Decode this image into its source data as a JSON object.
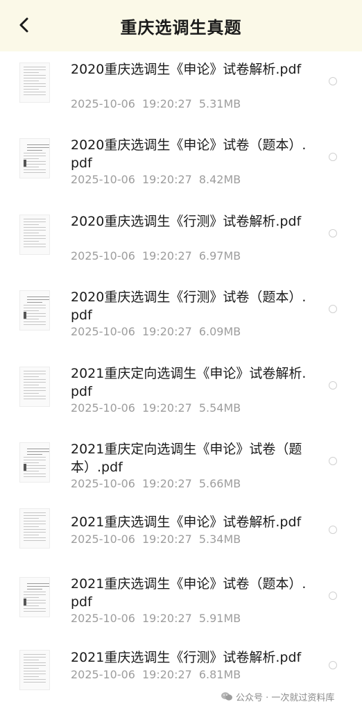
{
  "header": {
    "title": "重庆选调生真题",
    "back_icon": "back-arrow-icon"
  },
  "files": [
    {
      "name": "2020重庆选调生《申论》试卷解析.pdf",
      "date": "2025-10-06",
      "time": "19:20:27",
      "size": "5.31MB"
    },
    {
      "name": "2020重庆选调生《申论》试卷（题本）.pdf",
      "date": "2025-10-06",
      "time": "19:20:27",
      "size": "8.42MB"
    },
    {
      "name": "2020重庆选调生《行测》试卷解析.pdf",
      "date": "2025-10-06",
      "time": "19:20:27",
      "size": "6.97MB"
    },
    {
      "name": "2020重庆选调生《行测》试卷（题本）.pdf",
      "date": "2025-10-06",
      "time": "19:20:27",
      "size": "6.09MB"
    },
    {
      "name": "2021重庆定向选调生《申论》试卷解析.pdf",
      "date": "2025-10-06",
      "time": "19:20:27",
      "size": "5.54MB"
    },
    {
      "name": "2021重庆定向选调生《申论》试卷（题本）.pdf",
      "date": "2025-10-06",
      "time": "19:20:27",
      "size": "5.66MB"
    },
    {
      "name": "2021重庆选调生《申论》试卷解析.pdf",
      "date": "2025-10-06",
      "time": "19:20:27",
      "size": "5.34MB"
    },
    {
      "name": "2021重庆选调生《申论》试卷（题本）.pdf",
      "date": "2025-10-06",
      "time": "19:20:27",
      "size": "5.91MB"
    },
    {
      "name": "2021重庆选调生《行测》试卷解析.pdf",
      "date": "2025-10-06",
      "time": "19:20:27",
      "size": "6.81MB"
    }
  ],
  "watermark": {
    "text": "公众号 · 一次就过资料库",
    "icon": "wechat-icon"
  },
  "colors": {
    "header_bg": "#fbf9e8",
    "text": "#1a1a1a",
    "meta": "#9d9d9d",
    "radio_border": "#d0d0d0"
  }
}
